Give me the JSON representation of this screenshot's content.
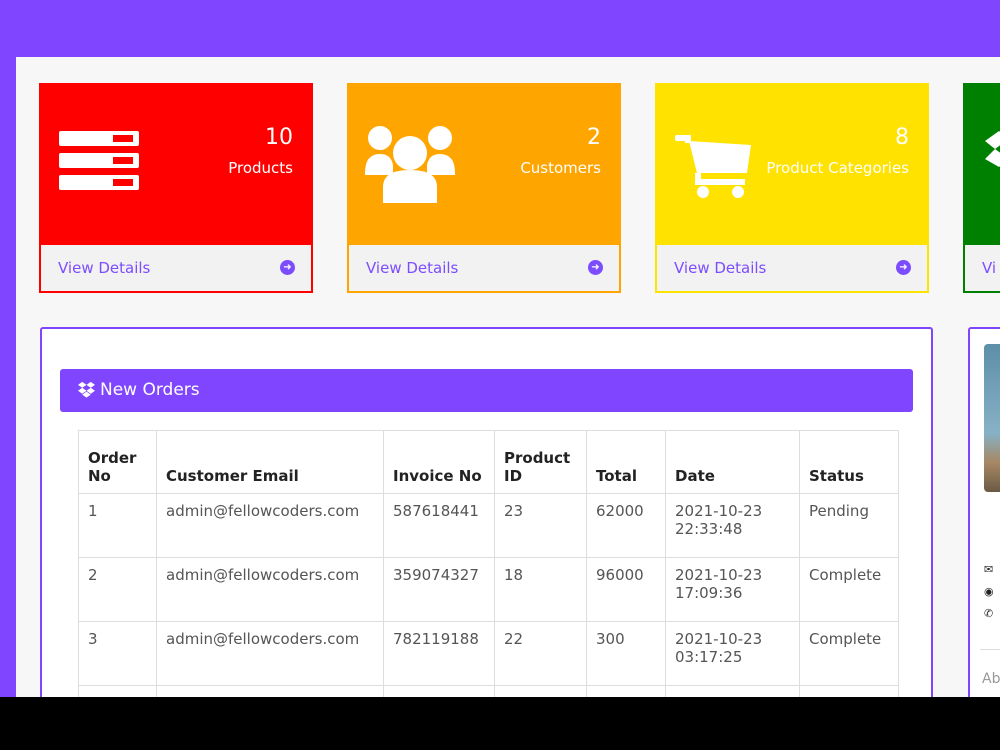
{
  "cards": [
    {
      "count": "10",
      "label": "Products",
      "link": "View Details",
      "color": "#ff0000",
      "icon": "server-list-icon"
    },
    {
      "count": "2",
      "label": "Customers",
      "link": "View Details",
      "color": "#ffa500",
      "icon": "users-icon"
    },
    {
      "count": "8",
      "label": "Product Categories",
      "link": "View Details",
      "color": "#ffe200",
      "icon": "shopping-cart-icon"
    },
    {
      "count": "",
      "label": "",
      "link": "Vi",
      "color": "#008000",
      "icon": "dropbox-icon"
    }
  ],
  "orders_panel": {
    "title": "New Orders",
    "icon": "dropbox-icon",
    "columns": [
      "Order No",
      "Customer Email",
      "Invoice No",
      "Product ID",
      "Total",
      "Date",
      "Status"
    ],
    "rows": [
      {
        "order_no": "1",
        "email": "admin@fellowcoders.com",
        "invoice": "587618441",
        "product_id": "23",
        "total": "62000",
        "date": "2021-10-23 22:33:48",
        "status": "Pending"
      },
      {
        "order_no": "2",
        "email": "admin@fellowcoders.com",
        "invoice": "359074327",
        "product_id": "18",
        "total": "96000",
        "date": "2021-10-23 17:09:36",
        "status": "Complete"
      },
      {
        "order_no": "3",
        "email": "admin@fellowcoders.com",
        "invoice": "782119188",
        "product_id": "22",
        "total": "300",
        "date": "2021-10-23 03:17:25",
        "status": "Complete"
      }
    ]
  },
  "profile_panel": {
    "about_label": "Ab",
    "icons": [
      "envelope-icon",
      "globe-icon",
      "phone-icon"
    ]
  },
  "colors": {
    "accent": "#8046ff",
    "link": "#7c4dff"
  }
}
